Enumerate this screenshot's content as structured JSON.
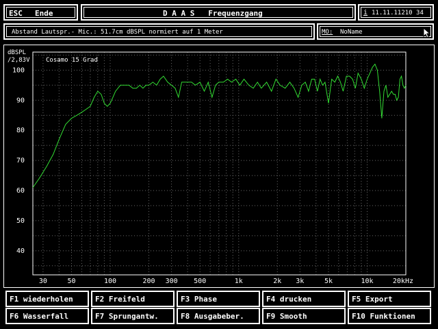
{
  "header": {
    "esc_label": "ESC",
    "end_label": "Ende",
    "title": "D A A S   Frequenzgang",
    "info_icon": "i",
    "datetime": "11.11.11210 34"
  },
  "infobar": {
    "description": "Abstand Lautspr.- Mic.: 51.7cm dBSPL normiert auf 1 Meter",
    "name_label": "MO:",
    "name_value": "NoName"
  },
  "colors": {
    "curve": "#33dd33",
    "grid": "#6a6a6a",
    "frame": "#ffffff",
    "background": "#000000"
  },
  "chart_data": {
    "type": "line",
    "title": "Cosamo 15 Grad",
    "ylabel_line1": "dBSPL",
    "ylabel_line2": "/2,83V",
    "xscale": "log",
    "xlim": [
      25,
      20000
    ],
    "ylim": [
      32,
      106
    ],
    "y_ticks": [
      40,
      50,
      60,
      70,
      80,
      90,
      100
    ],
    "x_ticks": [
      {
        "v": 30,
        "label": "30"
      },
      {
        "v": 50,
        "label": "50"
      },
      {
        "v": 100,
        "label": "100"
      },
      {
        "v": 200,
        "label": "200"
      },
      {
        "v": 300,
        "label": "300"
      },
      {
        "v": 500,
        "label": "500"
      },
      {
        "v": 1000,
        "label": "1k"
      },
      {
        "v": 2000,
        "label": "2k"
      },
      {
        "v": 3000,
        "label": "3k"
      },
      {
        "v": 5000,
        "label": "5k"
      },
      {
        "v": 10000,
        "label": "10k"
      },
      {
        "v": 20000,
        "label": "20kHz"
      }
    ],
    "grid": true,
    "series": [
      {
        "x": [
          25,
          28,
          32,
          36,
          40,
          45,
          50,
          55,
          60,
          65,
          70,
          75,
          80,
          85,
          90,
          95,
          100,
          105,
          110,
          120,
          130,
          140,
          150,
          160,
          170,
          180,
          190,
          200,
          215,
          230,
          245,
          260,
          280,
          300,
          320,
          340,
          360,
          380,
          400,
          430,
          460,
          500,
          540,
          580,
          620,
          660,
          700,
          760,
          820,
          880,
          950,
          1020,
          1100,
          1200,
          1300,
          1400,
          1500,
          1650,
          1800,
          1950,
          2100,
          2300,
          2500,
          2700,
          2900,
          3100,
          3300,
          3500,
          3700,
          3900,
          4100,
          4300,
          4500,
          4700,
          5000,
          5300,
          5600,
          5900,
          6200,
          6500,
          6900,
          7300,
          7700,
          8100,
          8500,
          9000,
          9500,
          10000,
          10500,
          11000,
          11500,
          12000,
          12500,
          13000,
          13500,
          14000,
          14500,
          15000,
          15500,
          16000,
          16500,
          17000,
          17500,
          18000,
          18500,
          19000,
          19500,
          20000
        ],
        "y": [
          61,
          64,
          68,
          72,
          77,
          82,
          84,
          85,
          86,
          87,
          88,
          91,
          93,
          92,
          89,
          88,
          89,
          91,
          93,
          95,
          95,
          95,
          94,
          94,
          95,
          94,
          95,
          95,
          96,
          95,
          97,
          98,
          96,
          95,
          94,
          91,
          96,
          96,
          96,
          96,
          95,
          96,
          93,
          96,
          91,
          95,
          96,
          96,
          97,
          96,
          97,
          95,
          97,
          95,
          94,
          96,
          94,
          96,
          93,
          97,
          95,
          94,
          96,
          94,
          91,
          95,
          96,
          93,
          97,
          97,
          93,
          97,
          95,
          96,
          89,
          97,
          96,
          98,
          96,
          93,
          98,
          98,
          97,
          94,
          99,
          97,
          94,
          97,
          99,
          101,
          102,
          100,
          93,
          84,
          93,
          95,
          91,
          92,
          93,
          92,
          92,
          90,
          91,
          97,
          98,
          95,
          94,
          95
        ]
      }
    ]
  },
  "fkeys": [
    {
      "label": "F1 wiederholen"
    },
    {
      "label": "F2 Freifeld"
    },
    {
      "label": "F3 Phase"
    },
    {
      "label": "F4 drucken"
    },
    {
      "label": "F5 Export"
    },
    {
      "label": "F6 Wasserfall"
    },
    {
      "label": "F7 Sprungantw."
    },
    {
      "label": "F8 Ausgabeber."
    },
    {
      "label": "F9 Smooth"
    },
    {
      "label": "F10 Funktionen"
    }
  ]
}
